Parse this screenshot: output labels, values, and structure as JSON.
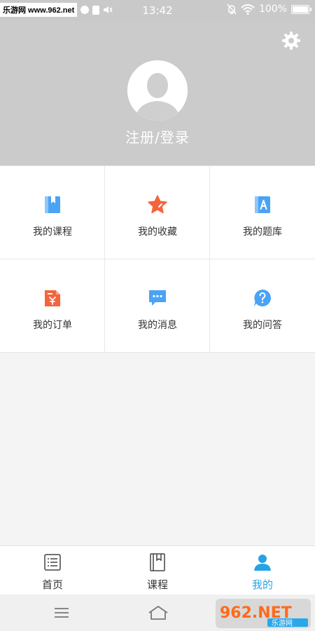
{
  "status_bar": {
    "watermark": "乐游网 www.962.net",
    "time": "13:42",
    "battery": "100%"
  },
  "profile": {
    "login_label": "注册/登录",
    "settings_icon": "gear-icon",
    "avatar_icon": "avatar-placeholder"
  },
  "menu": [
    {
      "label": "我的课程",
      "icon": "course-book-icon",
      "color": "#4aa3f5"
    },
    {
      "label": "我的收藏",
      "icon": "star-icon",
      "color": "#f5643c"
    },
    {
      "label": "我的题库",
      "icon": "question-bank-icon",
      "color": "#4aa3f5"
    },
    {
      "label": "我的订单",
      "icon": "order-icon",
      "color": "#f5643c"
    },
    {
      "label": "我的消息",
      "icon": "message-icon",
      "color": "#4aa3f5"
    },
    {
      "label": "我的问答",
      "icon": "qa-icon",
      "color": "#4aa3f5"
    }
  ],
  "tabs": [
    {
      "label": "首页",
      "icon": "home-list-icon",
      "active": false
    },
    {
      "label": "课程",
      "icon": "course-icon",
      "active": false
    },
    {
      "label": "我的",
      "icon": "user-icon",
      "active": true
    }
  ],
  "colors": {
    "accent": "#25a3e6",
    "header_bg": "#cbcbcb",
    "blue_icon": "#4aa3f5",
    "orange_icon": "#f5643c"
  },
  "brand": {
    "logo_text": "962.NET",
    "logo_subtext": "乐游网"
  }
}
